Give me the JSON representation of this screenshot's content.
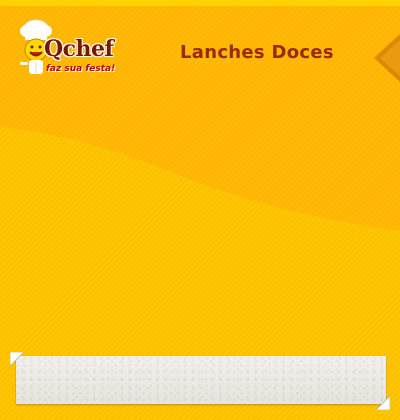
{
  "brand": {
    "name": "Qchef",
    "tagline": "faz sua festa!"
  },
  "header": {
    "section_title": "Lanches Doces"
  },
  "colors": {
    "background": "#ffc400",
    "top_band": "#ffb400",
    "title": "#9a2a00",
    "arrow": "#d98a00",
    "paper": "#efede8"
  },
  "icons": {
    "logo": "chef-smiley-icon",
    "nav": "triangle-left-icon"
  }
}
